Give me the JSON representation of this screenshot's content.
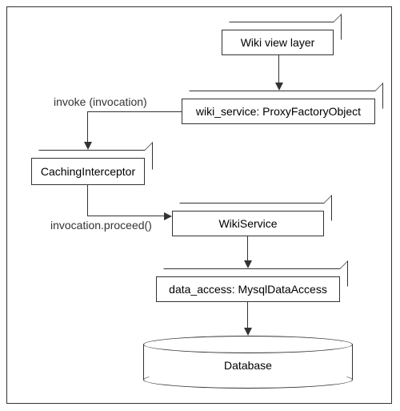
{
  "chart_data": {
    "type": "diagram",
    "title": "",
    "nodes": [
      {
        "id": "view",
        "label": "Wiki view layer",
        "shape": "box3d"
      },
      {
        "id": "proxy",
        "label": "wiki_service: ProxyFactoryObject",
        "shape": "box3d"
      },
      {
        "id": "interceptor",
        "label": "CachingInterceptor",
        "shape": "box3d"
      },
      {
        "id": "service",
        "label": "WikiService",
        "shape": "box3d"
      },
      {
        "id": "dao",
        "label": "data_access: MysqlDataAccess",
        "shape": "box3d"
      },
      {
        "id": "db",
        "label": "Database",
        "shape": "cylinder"
      }
    ],
    "edges": [
      {
        "from": "view",
        "to": "proxy",
        "label": ""
      },
      {
        "from": "proxy",
        "to": "interceptor",
        "label": "invoke (invocation)"
      },
      {
        "from": "interceptor",
        "to": "service",
        "label": "invocation.proceed()"
      },
      {
        "from": "service",
        "to": "dao",
        "label": ""
      },
      {
        "from": "dao",
        "to": "db",
        "label": ""
      }
    ]
  }
}
